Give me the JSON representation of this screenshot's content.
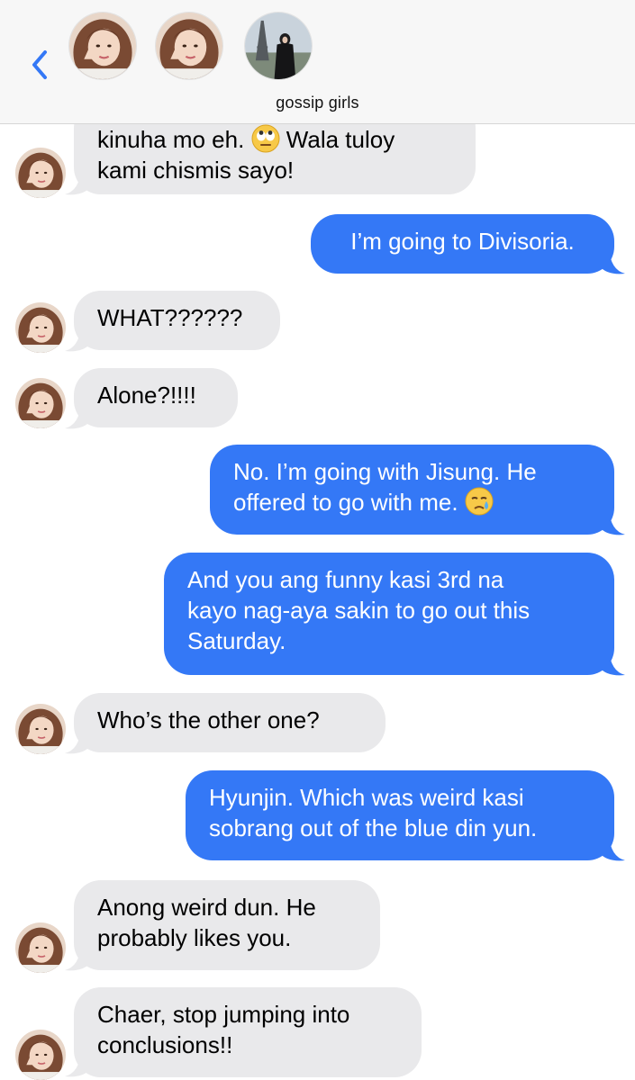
{
  "header": {
    "group_name": "gossip girls",
    "back_icon": "chevron-left-icon",
    "accent": "#3478f6"
  },
  "colors": {
    "incoming_bubble": "#e9e9eb",
    "outgoing_bubble": "#3478f6"
  },
  "messages": [
    {
      "from": "incoming",
      "lines": [
        "kinuha mo eh.",
        "Wala tuloy",
        "kami chismis sayo!"
      ],
      "emoji": "eye-roll-emoji"
    },
    {
      "from": "outgoing",
      "lines": [
        "I’m going to Divisoria."
      ]
    },
    {
      "from": "incoming",
      "lines": [
        "WHAT??????"
      ]
    },
    {
      "from": "incoming",
      "lines": [
        "Alone?!!!!"
      ]
    },
    {
      "from": "outgoing",
      "lines": [
        "No. I’m going with Jisung. He",
        "offered to go with me."
      ],
      "emoji": "crying-face-emoji"
    },
    {
      "from": "outgoing",
      "lines": [
        "And you ang funny kasi 3rd na",
        "kayo nag-aya sakin to go out this",
        "Saturday."
      ]
    },
    {
      "from": "incoming",
      "lines": [
        "Who’s the other one?"
      ]
    },
    {
      "from": "outgoing",
      "lines": [
        "Hyunjin. Which was weird kasi",
        "sobrang out of the blue din yun."
      ]
    },
    {
      "from": "incoming",
      "lines": [
        "Anong weird dun. He",
        "probably likes you."
      ]
    },
    {
      "from": "incoming",
      "lines": [
        "Chaer, stop jumping into",
        "conclusions!!"
      ]
    }
  ]
}
